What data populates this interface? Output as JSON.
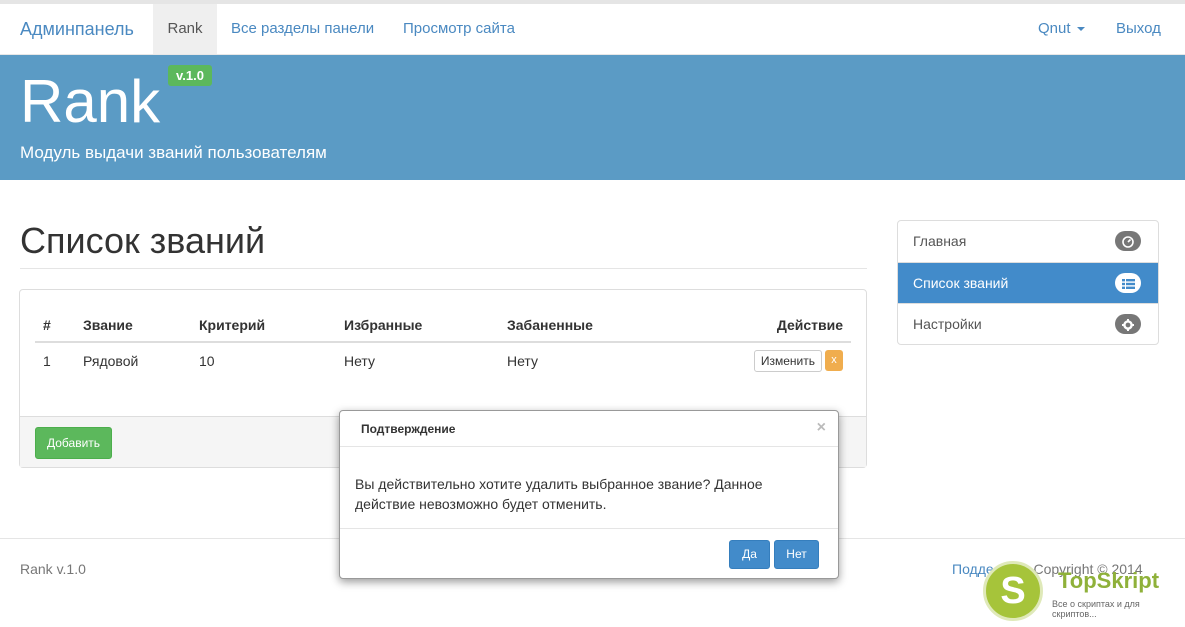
{
  "nav": {
    "brand": "Админпанель",
    "active_tab": "Rank",
    "links": [
      "Все разделы панели",
      "Просмотр сайта"
    ],
    "user": "Qnut",
    "exit": "Выход"
  },
  "hero": {
    "title": "Rank",
    "version": "v.1.0",
    "subtitle": "Модуль выдачи званий пользователям"
  },
  "page": {
    "title": "Список званий"
  },
  "table": {
    "headers": [
      "#",
      "Звание",
      "Критерий",
      "Избранные",
      "Забаненные",
      "Действие"
    ],
    "rows": [
      {
        "num": "1",
        "rank": "Рядовой",
        "criterion": "10",
        "favorites": "Нету",
        "banned": "Нету",
        "edit": "Изменить",
        "delete": "x"
      }
    ]
  },
  "panel": {
    "add_button": "Добавить"
  },
  "sidebar": {
    "items": [
      {
        "label": "Главная",
        "icon": "dashboard-icon",
        "active": false
      },
      {
        "label": "Список званий",
        "icon": "list-icon",
        "active": true
      },
      {
        "label": "Настройки",
        "icon": "gear-icon",
        "active": false
      }
    ]
  },
  "footer": {
    "left": "Rank v.1.0",
    "support": "Подде",
    "copyright": "Copyright © 2014"
  },
  "modal": {
    "title": "Подтверждение",
    "close": "×",
    "body": "Вы действительно хотите удалить выбранное звание? Данное действие невозможно будет отменить.",
    "yes": "Да",
    "no": "Нет"
  },
  "watermark": {
    "logo": "S",
    "name": "TopSkript",
    "tagline": "Все о скриптах и для скриптов..."
  },
  "colors": {
    "hero_bg": "#5b9bc5",
    "accent": "#428bca",
    "success": "#5cb85c",
    "warning": "#f0ad4e"
  }
}
